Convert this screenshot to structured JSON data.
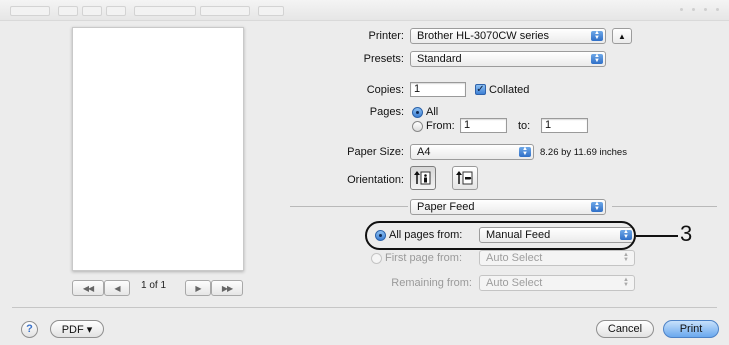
{
  "printer": {
    "label": "Printer:",
    "value": "Brother HL-3070CW series"
  },
  "presets": {
    "label": "Presets:",
    "value": "Standard"
  },
  "copies": {
    "label": "Copies:",
    "value": "1",
    "collated_label": "Collated",
    "collated_checked": true
  },
  "pages": {
    "label": "Pages:",
    "all_label": "All",
    "from_label": "From:",
    "from_value": "1",
    "to_label": "to:",
    "to_value": "1"
  },
  "paper_size": {
    "label": "Paper Size:",
    "value": "A4",
    "dimensions": "8.26 by 11.69 inches"
  },
  "orientation": {
    "label": "Orientation:",
    "selected": "portrait"
  },
  "section_popup": {
    "value": "Paper Feed"
  },
  "feed": {
    "all_pages_label": "All pages from:",
    "all_pages_value": "Manual Feed",
    "first_page_label": "First page from:",
    "first_page_value": "Auto Select",
    "remaining_label": "Remaining from:",
    "remaining_value": "Auto Select"
  },
  "preview": {
    "page_count": "1 of 1"
  },
  "callout": {
    "number": "3"
  },
  "footer": {
    "help": "?",
    "pdf_label": "PDF ▾",
    "cancel_label": "Cancel",
    "print_label": "Print"
  },
  "colors": {
    "accent": "#3d7fd4",
    "background": "#ececec"
  }
}
